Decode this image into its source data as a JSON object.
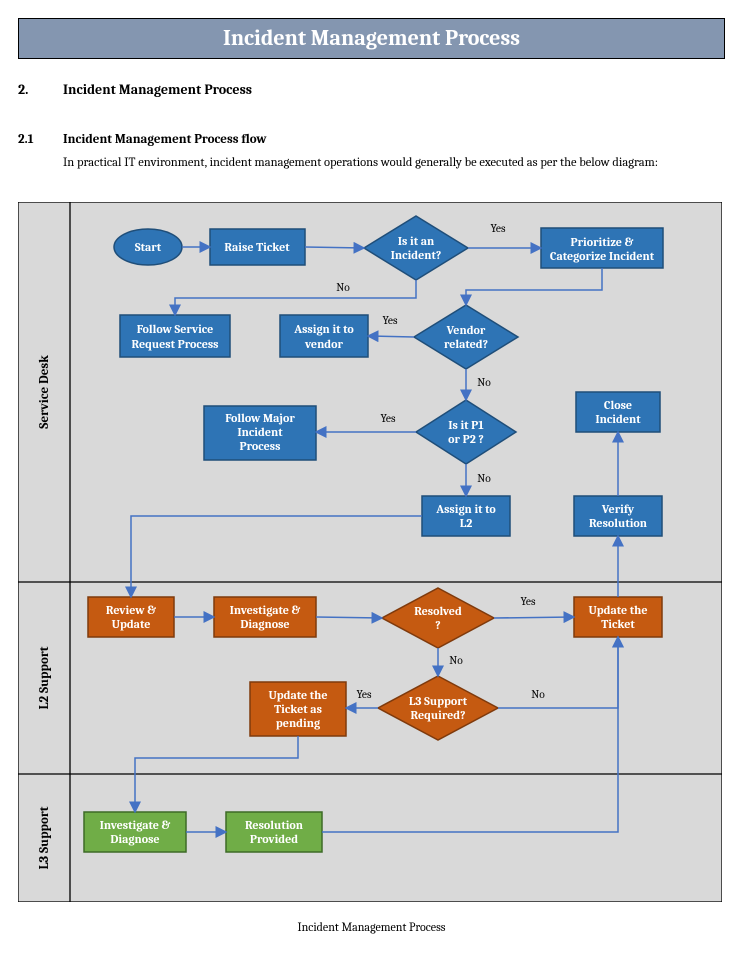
{
  "header": {
    "title": "Incident Management Process"
  },
  "section": {
    "num": "2.",
    "title": "Incident Management Process"
  },
  "subsection": {
    "num": "2.1",
    "title": "Incident Management Process flow"
  },
  "body": "In practical IT environment, incident management operations would generally be executed as per the below diagram:",
  "footer": "Incident Management Process",
  "lanes": {
    "l1": "Service Desk",
    "l2": "L2 Support",
    "l3": "L3 Support"
  },
  "nodes": {
    "start": "Start",
    "raise": "Raise Ticket",
    "isIncident": {
      "l1": "Is it an",
      "l2": "Incident?"
    },
    "prioritize": {
      "l1": "Prioritize &",
      "l2": "Categorize Incident"
    },
    "srq": {
      "l1": "Follow Service",
      "l2": "Request Process"
    },
    "assignVendor": {
      "l1": "Assign it to",
      "l2": "vendor"
    },
    "vendor": {
      "l1": "Vendor",
      "l2": "related?"
    },
    "major": {
      "l1": "Follow Major",
      "l2": "Incident",
      "l3": "Process"
    },
    "p1p2": {
      "l1": "Is it P1",
      "l2": "or P2 ?"
    },
    "assignL2": {
      "l1": "Assign it to",
      "l2": "L2"
    },
    "close": {
      "l1": "Close",
      "l2": "Incident"
    },
    "verify": {
      "l1": "Verify",
      "l2": "Resolution"
    },
    "review": {
      "l1": "Review &",
      "l2": "Update"
    },
    "invest2": {
      "l1": "Investigate &",
      "l2": "Diagnose"
    },
    "resolved": {
      "l1": "Resolved",
      "l2": "?"
    },
    "updateTicket": {
      "l1": "Update the",
      "l2": "Ticket"
    },
    "updatePending": {
      "l1": "Update the",
      "l2": "Ticket as",
      "l3": "pending"
    },
    "l3req": {
      "l1": "L3 Support",
      "l2": "Required?"
    },
    "invest3": {
      "l1": "Investigate &",
      "l2": "Diagnose"
    },
    "resProvided": {
      "l1": "Resolution",
      "l2": "Provided"
    }
  },
  "labels": {
    "yes": "Yes",
    "no": "No"
  }
}
